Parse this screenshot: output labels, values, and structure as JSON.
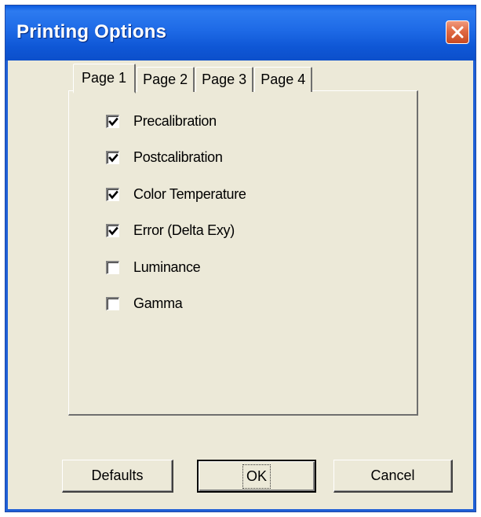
{
  "window": {
    "title": "Printing Options"
  },
  "tabs": [
    {
      "label": "Page 1",
      "active": true
    },
    {
      "label": "Page 2",
      "active": false
    },
    {
      "label": "Page 3",
      "active": false
    },
    {
      "label": "Page 4",
      "active": false
    }
  ],
  "options": [
    {
      "label": "Precalibration",
      "checked": true
    },
    {
      "label": "Postcalibration",
      "checked": true
    },
    {
      "label": "Color Temperature",
      "checked": true
    },
    {
      "label": "Error (Delta Exy)",
      "checked": true
    },
    {
      "label": "Luminance",
      "checked": false
    },
    {
      "label": "Gamma",
      "checked": false
    }
  ],
  "buttons": {
    "defaults": "Defaults",
    "ok": "OK",
    "cancel": "Cancel"
  },
  "icons": {
    "close": "close-icon",
    "check": "check-icon"
  },
  "colors": {
    "titlebar": "#0f57d6",
    "dialog_bg": "#ece9d8",
    "close_button": "#e06a44"
  }
}
